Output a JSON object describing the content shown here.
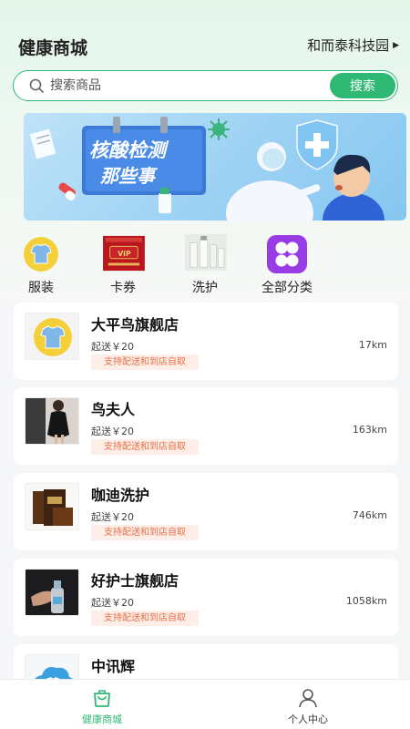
{
  "header": {
    "title": "健康商城",
    "location": "和而泰科技园"
  },
  "search": {
    "placeholder": "搜索商品",
    "button_label": "搜索"
  },
  "banner": {
    "line1": "核酸检测",
    "line2": "那些事"
  },
  "categories": [
    {
      "label": "服装",
      "icon": "tshirt-icon"
    },
    {
      "label": "卡券",
      "icon": "voucher-icon",
      "img_text": "VIP"
    },
    {
      "label": "洗护",
      "icon": "skincare-icon"
    },
    {
      "label": "全部分类",
      "icon": "grid-icon"
    }
  ],
  "stores": [
    {
      "name": "大平鸟旗舰店",
      "min_order": "起送￥20",
      "distance": "17km",
      "tag": "支持配送和到店自取"
    },
    {
      "name": "鸟夫人",
      "min_order": "起送￥20",
      "distance": "163km",
      "tag": "支持配送和到店自取"
    },
    {
      "name": "咖迪洗护",
      "min_order": "起送￥20",
      "distance": "746km",
      "tag": "支持配送和到店自取"
    },
    {
      "name": "好护士旗舰店",
      "min_order": "起送￥20",
      "distance": "1058km",
      "tag": "支持配送和到店自取"
    },
    {
      "name": "中讯辉"
    }
  ],
  "tabbar": [
    {
      "label": "健康商城",
      "active": true
    },
    {
      "label": "个人中心",
      "active": false
    }
  ],
  "colors": {
    "accent": "#2fb873",
    "tag_bg": "#fdeee7",
    "tag_text": "#e8714a"
  }
}
